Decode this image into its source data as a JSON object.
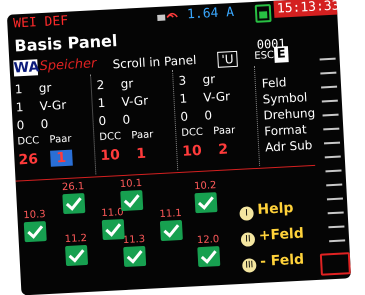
{
  "topbar": {
    "title": "WEI DEF",
    "current": "1.64 A",
    "clock": "15:13:33"
  },
  "panel": {
    "title": "Basis Panel",
    "number": "0001"
  },
  "modebar": {
    "w_label": "WA",
    "speicher": "Speicher",
    "scroll": "Scroll in Panel",
    "u_label": "'U",
    "esc": "ESC",
    "e_label": "E"
  },
  "slots": [
    {
      "n": "1",
      "gr": "gr",
      "v": "1",
      "vgr": "V-Gr",
      "a": "0",
      "b": "0",
      "dcc": "DCC",
      "paar": "Paar",
      "dcc_val": "26",
      "paar_val": "1"
    },
    {
      "n": "2",
      "gr": "gr",
      "v": "1",
      "vgr": "V-Gr",
      "a": "0",
      "b": "0",
      "dcc": "DCC",
      "paar": "Paar",
      "dcc_val": "10",
      "paar_val": "1"
    },
    {
      "n": "3",
      "gr": "gr",
      "v": "1",
      "vgr": "V-Gr",
      "a": "0",
      "b": "0",
      "dcc": "DCC",
      "paar": "Paar",
      "dcc_val": "10",
      "paar_val": "2"
    }
  ],
  "menu": [
    "Feld",
    "Symbol",
    "Drehung",
    "Format",
    "Adr Sub"
  ],
  "checks": {
    "c1": "26.1",
    "c2": "10.1",
    "c3": "10.2",
    "c4": "10.3",
    "c5": "11.0",
    "c6": "11.1",
    "c7": "11.2",
    "c8": "11.3",
    "c9": "12.0"
  },
  "help": {
    "help_label": "Help",
    "plus_label": "+Feld",
    "minus_label": "- Feld",
    "help_key": "I",
    "plus_key": "II",
    "minus_key": "III"
  }
}
